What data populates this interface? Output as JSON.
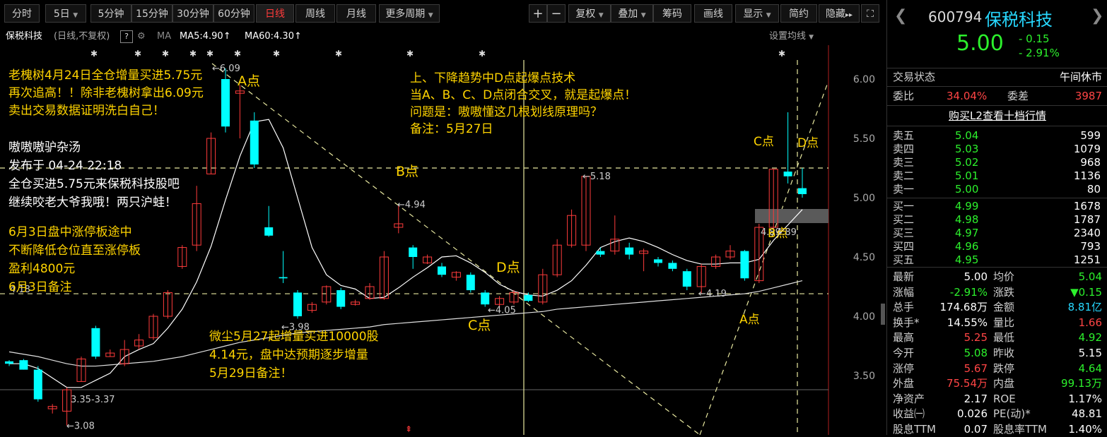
{
  "toolbar": {
    "period_tabs": [
      "分时",
      "5日",
      "5分钟",
      "15分钟",
      "30分钟",
      "60分钟",
      "日线",
      "周线",
      "月线",
      "更多周期"
    ],
    "active_tab": "日线",
    "zoom_in": "+",
    "zoom_out": "−",
    "adjust": "复权",
    "overlay": "叠加",
    "chips": "筹码",
    "draw": "画线",
    "display": "显示",
    "simple": "简约",
    "hide": "隐藏",
    "expand": "▸▸"
  },
  "chart_header": {
    "stock_name": "保税科技",
    "mode": "(日线,不复权)",
    "help": "?",
    "ma_label": "MA",
    "ma5": "MA5:4.90↑",
    "ma60": "MA60:4.30↑",
    "ma_settings": "设置均线"
  },
  "chart_data": {
    "type": "candlestick",
    "y_ticks": [
      "6.00",
      "5.50",
      "5.00",
      "4.50",
      "4.00",
      "3.50"
    ],
    "ylim": [
      3.05,
      6.25
    ],
    "x_range": [
      0,
      59
    ],
    "candles": [
      [
        0,
        3.62,
        3.6,
        3.63,
        3.58
      ],
      [
        1,
        3.63,
        3.55,
        3.64,
        3.55
      ],
      [
        2,
        3.55,
        3.3,
        3.58,
        3.28
      ],
      [
        3,
        3.22,
        3.24,
        3.26,
        3.18
      ],
      [
        4,
        3.2,
        3.38,
        3.4,
        3.08
      ],
      [
        5,
        3.45,
        3.64,
        3.66,
        3.45
      ],
      [
        6,
        3.9,
        3.66,
        3.92,
        3.64
      ],
      [
        7,
        3.66,
        3.69,
        3.72,
        3.66
      ],
      [
        8,
        3.6,
        3.72,
        3.8,
        3.58
      ],
      [
        9,
        3.75,
        3.8,
        3.85,
        3.72
      ],
      [
        10,
        3.82,
        4.0,
        4.02,
        3.8
      ],
      [
        11,
        4.0,
        4.2,
        4.22,
        3.98
      ],
      [
        12,
        4.42,
        4.58,
        4.6,
        4.4
      ],
      [
        13,
        4.6,
        4.95,
        5.1,
        4.55
      ],
      [
        14,
        5.2,
        5.5,
        5.55,
        5.2
      ],
      [
        15,
        6.0,
        5.6,
        6.09,
        5.55
      ],
      [
        16,
        5.88,
        5.9,
        5.95,
        5.5
      ],
      [
        17,
        5.65,
        5.28,
        5.72,
        5.25
      ],
      [
        18,
        4.75,
        4.68,
        4.93,
        4.67
      ],
      [
        19,
        4.33,
        4.32,
        4.55,
        4.28
      ],
      [
        20,
        4.2,
        4.0,
        4.22,
        3.98
      ],
      [
        21,
        4.05,
        4.1,
        4.12,
        4.03
      ],
      [
        22,
        4.12,
        4.25,
        4.26,
        4.1
      ],
      [
        23,
        4.22,
        4.08,
        4.24,
        4.06
      ],
      [
        24,
        4.1,
        4.12,
        4.14,
        4.09
      ],
      [
        25,
        4.15,
        4.25,
        4.28,
        4.14
      ],
      [
        26,
        4.15,
        4.5,
        4.55,
        4.14
      ],
      [
        27,
        4.75,
        4.78,
        4.94,
        4.7
      ],
      [
        28,
        4.58,
        4.5,
        4.6,
        4.4
      ],
      [
        29,
        4.45,
        4.5,
        4.52,
        4.44
      ],
      [
        30,
        4.42,
        4.35,
        4.45,
        4.33
      ],
      [
        31,
        4.33,
        4.37,
        4.38,
        4.3
      ],
      [
        32,
        4.35,
        4.22,
        4.37,
        4.2
      ],
      [
        33,
        4.2,
        4.1,
        4.22,
        4.08
      ],
      [
        34,
        4.1,
        4.15,
        4.17,
        4.08
      ],
      [
        35,
        4.12,
        4.2,
        4.22,
        4.1
      ],
      [
        36,
        4.18,
        4.13,
        4.2,
        4.12
      ],
      [
        37,
        4.12,
        4.35,
        4.4,
        4.1
      ],
      [
        38,
        4.35,
        4.6,
        4.65,
        4.33
      ],
      [
        39,
        4.6,
        4.85,
        4.9,
        4.58
      ],
      [
        40,
        4.6,
        5.18,
        5.18,
        4.55
      ],
      [
        41,
        4.55,
        4.52,
        4.58,
        4.5
      ],
      [
        42,
        4.55,
        4.65,
        4.85,
        4.52
      ],
      [
        43,
        4.58,
        4.52,
        4.62,
        4.48
      ],
      [
        44,
        4.53,
        4.55,
        4.57,
        4.38
      ],
      [
        45,
        4.48,
        4.45,
        4.5,
        4.42
      ],
      [
        46,
        4.45,
        4.4,
        4.47,
        4.38
      ],
      [
        47,
        4.38,
        4.25,
        4.4,
        4.22
      ],
      [
        48,
        4.25,
        4.42,
        4.44,
        4.19
      ],
      [
        49,
        4.42,
        4.5,
        4.52,
        4.4
      ],
      [
        50,
        4.5,
        4.55,
        4.6,
        4.48
      ],
      [
        51,
        4.55,
        4.32,
        4.56,
        4.3
      ],
      [
        52,
        4.3,
        4.75,
        4.78,
        4.28
      ],
      [
        53,
        4.75,
        5.24,
        5.24,
        4.73
      ],
      [
        54,
        5.22,
        5.18,
        5.72,
        5.12
      ],
      [
        55,
        5.08,
        5.03,
        5.25,
        5.0
      ]
    ],
    "ma5": [
      3.6,
      3.6,
      3.56,
      3.48,
      3.4,
      3.4,
      3.46,
      3.52,
      3.66,
      3.72,
      3.77,
      3.9,
      4.06,
      4.29,
      4.59,
      4.98,
      5.35,
      5.64,
      5.66,
      5.42,
      5.0,
      4.58,
      4.35,
      4.26,
      4.23,
      4.15,
      4.16,
      4.24,
      4.33,
      4.41,
      4.5,
      4.51,
      4.45,
      4.37,
      4.27,
      4.21,
      4.18,
      4.17,
      4.22,
      4.3,
      4.43,
      4.58,
      4.63,
      4.66,
      4.63,
      4.58,
      4.52,
      4.47,
      4.44,
      4.44,
      4.45,
      4.45,
      4.48,
      4.64,
      4.77,
      4.9
    ],
    "ma60": [
      3.7,
      3.68,
      3.66,
      3.63,
      3.6,
      3.58,
      3.58,
      3.59,
      3.6,
      3.61,
      3.62,
      3.64,
      3.66,
      3.69,
      3.72,
      3.75,
      3.78,
      3.8,
      3.82,
      3.84,
      3.86,
      3.87,
      3.88,
      3.89,
      3.9,
      3.91,
      3.93,
      3.94,
      3.95,
      3.96,
      3.97,
      3.98,
      3.99,
      4.0,
      4.01,
      4.02,
      4.03,
      4.04,
      4.06,
      4.07,
      4.08,
      4.09,
      4.1,
      4.11,
      4.12,
      4.13,
      4.14,
      4.15,
      4.16,
      4.17,
      4.18,
      4.19,
      4.21,
      4.24,
      4.27,
      4.3
    ],
    "price_labels": {
      "high": "←6.09",
      "b_high": "←4.94",
      "low1": "←3.98",
      "low2": "←4.05",
      "peak2": "←5.18",
      "low3": "←4.19",
      "low_start": "←3.08",
      "range": "3.35-3.37",
      "ma_left": "4.18",
      "cursor": "4.89",
      "cursor_label": "4.89"
    },
    "point_labels": [
      "A点",
      "B点",
      "C点",
      "D点",
      "C点",
      "D点",
      "B点",
      "A点"
    ]
  },
  "annotations": {
    "a_yellow": [
      "老槐树4月24日全仓增量买进5.75元",
      "再次追高！！除非老槐树拿出6.09元",
      "卖出交易数据证明洗白自己！"
    ],
    "b_white": [
      "嗷嗷嗷驴杂汤",
      "发布于 04-24 22:18",
      "全仓买进5.75元来保税科技股吧",
      "继续咬老大爷我哦！两只沪蛙！"
    ],
    "c_yellow": [
      "6月3日盘中涨停板途中",
      "不断降低仓位直至涨停板",
      "盈利4800元",
      "6月3日备注"
    ],
    "d_yellow": [
      "上、下降趋势中D点起爆点技术",
      "当A、B、C、D点闭合交叉，就是起爆点！",
      "问题是：嗷嗷懂这几根划线原理吗？",
      "备注：5月27日"
    ],
    "e_yellow": [
      "微尘5月27起增量买进10000股",
      "4.14元，盘中达预期逐步增量",
      "5月29日备注！"
    ]
  },
  "quote": {
    "code": "600794",
    "name": "保税科技",
    "price": "5.00",
    "change": "- 0.15",
    "change_pct": "- 2.91%",
    "status_label": "交易状态",
    "status_value": "午间休市",
    "weibi_label": "委比",
    "weibi_value": "34.04%",
    "weicha_label": "委差",
    "weicha_value": "3987",
    "l2_link": "购买L2查看十档行情",
    "asks": [
      {
        "label": "卖五",
        "price": "5.04",
        "vol": "599"
      },
      {
        "label": "卖四",
        "price": "5.03",
        "vol": "1079"
      },
      {
        "label": "卖三",
        "price": "5.02",
        "vol": "968"
      },
      {
        "label": "卖二",
        "price": "5.01",
        "vol": "1136"
      },
      {
        "label": "卖一",
        "price": "5.00",
        "vol": "80"
      }
    ],
    "bids": [
      {
        "label": "买一",
        "price": "4.99",
        "vol": "1678"
      },
      {
        "label": "买二",
        "price": "4.98",
        "vol": "1787"
      },
      {
        "label": "买三",
        "price": "4.97",
        "vol": "2340"
      },
      {
        "label": "买四",
        "price": "4.96",
        "vol": "793"
      },
      {
        "label": "买五",
        "price": "4.95",
        "vol": "1251"
      }
    ],
    "stats": [
      {
        "l1": "最新",
        "v1": "5.00",
        "c1": "white",
        "l2": "均价",
        "v2": "5.04",
        "c2": "green"
      },
      {
        "l1": "涨幅",
        "v1": "-2.91%",
        "c1": "green",
        "l2": "涨跌",
        "v2": "▼0.15",
        "c2": "green"
      },
      {
        "l1": "总手",
        "v1": "174.68万",
        "c1": "white",
        "l2": "金额",
        "v2": "8.81亿",
        "c2": "cyan"
      },
      {
        "l1": "换手*",
        "v1": "14.55%",
        "c1": "white",
        "l2": "量比",
        "v2": "1.66",
        "c2": "red"
      },
      {
        "l1": "最高",
        "v1": "5.25",
        "c1": "red",
        "l2": "最低",
        "v2": "4.92",
        "c2": "green"
      },
      {
        "l1": "今开",
        "v1": "5.08",
        "c1": "green",
        "l2": "昨收",
        "v2": "5.15",
        "c2": "white"
      },
      {
        "l1": "涨停",
        "v1": "5.67",
        "c1": "red",
        "l2": "跌停",
        "v2": "4.64",
        "c2": "green"
      },
      {
        "l1": "外盘",
        "v1": "75.54万",
        "c1": "red",
        "l2": "内盘",
        "v2": "99.13万",
        "c2": "green"
      },
      {
        "l1": "净资产",
        "v1": "2.17",
        "c1": "white",
        "l2": "ROE",
        "v2": "1.17%",
        "c2": "white"
      },
      {
        "l1": "收益㈠",
        "v1": "0.026",
        "c1": "white",
        "l2": "PE(动)*",
        "v2": "48.81",
        "c2": "white"
      },
      {
        "l1": "股息TTM",
        "v1": "0.07",
        "c1": "white",
        "l2": "股息率TTM",
        "v2": "1.40%",
        "c2": "white"
      }
    ]
  }
}
